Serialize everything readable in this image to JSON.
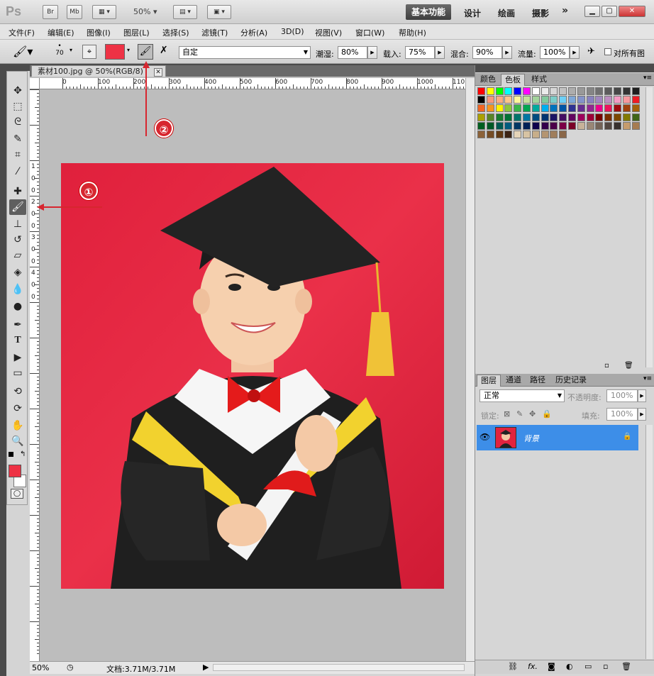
{
  "app": {
    "logo": "Ps",
    "bridge_btn": "Br",
    "minibridge_btn": "Mb",
    "zoom": "50%",
    "workspaces": [
      "基本功能",
      "设计",
      "绘画",
      "摄影"
    ],
    "more": "»"
  },
  "menu": [
    "文件(F)",
    "编辑(E)",
    "图像(I)",
    "图层(L)",
    "选择(S)",
    "滤镜(T)",
    "分析(A)",
    "3D(D)",
    "视图(V)",
    "窗口(W)",
    "帮助(H)"
  ],
  "options": {
    "brush_size": "70",
    "preset": "自定",
    "wet_label": "潮湿:",
    "wet_value": "80%",
    "load_label": "载入:",
    "load_value": "75%",
    "mix_label": "混合:",
    "mix_value": "90%",
    "flow_label": "流量:",
    "flow_value": "100%",
    "sample_all_label": "对所有图",
    "color": "#ee3245"
  },
  "document": {
    "tab_title": "素材100.jpg @ 50%(RGB/8)",
    "zoom": "50%",
    "doc_info": "文档:3.71M/3.71M",
    "ruler_h": [
      "0",
      "100",
      "200",
      "300",
      "400",
      "500",
      "600",
      "700",
      "800",
      "900",
      "1000",
      "110"
    ],
    "ruler_v": [
      "1",
      "0",
      "0",
      "2",
      "0",
      "0",
      "3",
      "0",
      "0",
      "4",
      "0",
      "0"
    ]
  },
  "annotations": [
    "①",
    "②"
  ],
  "panels": {
    "swatch_tabs": [
      "颜色",
      "色板",
      "样式"
    ],
    "active_swatch_tab": "色板",
    "layer_tabs": [
      "图层",
      "通道",
      "路径",
      "历史记录"
    ],
    "blend_mode": "正常",
    "opacity_label": "不透明度:",
    "opacity": "100%",
    "lock_label": "锁定:",
    "fill_label": "填充:",
    "fill": "100%",
    "layer_name": "背景"
  },
  "colors": {
    "accent": "#3d8ee8",
    "photo_bg": "#e2233f",
    "annotation": "#d7262f"
  }
}
